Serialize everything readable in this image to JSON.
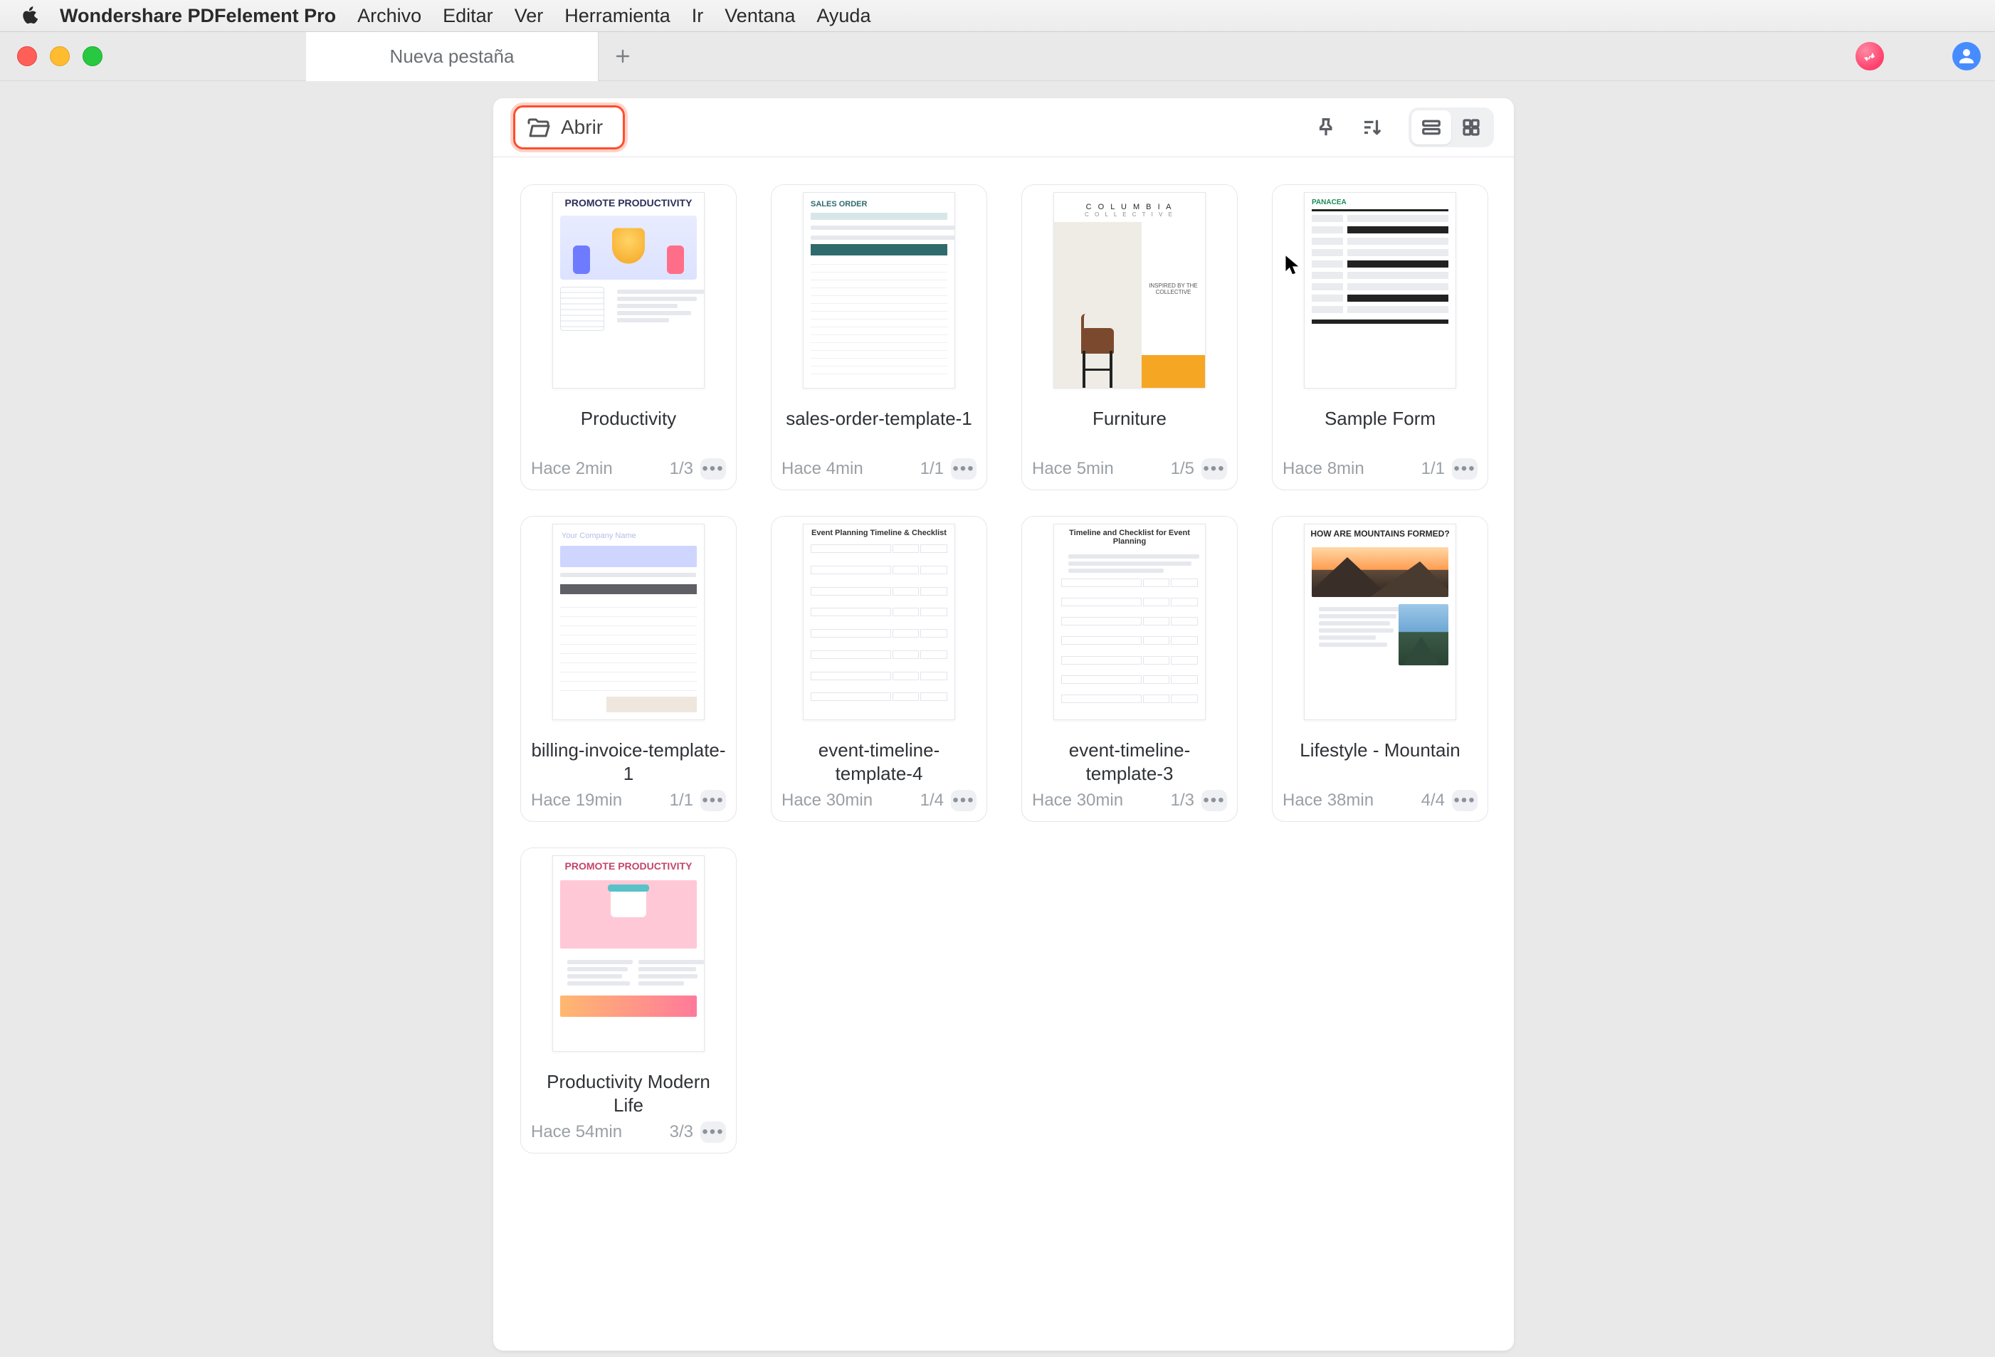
{
  "menubar": {
    "app_name": "Wondershare PDFelement Pro",
    "items": [
      "Archivo",
      "Editar",
      "Ver",
      "Herramienta",
      "Ir",
      "Ventana",
      "Ayuda"
    ]
  },
  "tabbar": {
    "tab_label": "Nueva pestaña"
  },
  "panel": {
    "open_label": "Abrir"
  },
  "files": [
    {
      "name": "Productivity",
      "time": "Hace 2min",
      "pages": "1/3",
      "thumb": "productivity"
    },
    {
      "name": "sales-order-template-1",
      "time": "Hace 4min",
      "pages": "1/1",
      "thumb": "sales"
    },
    {
      "name": "Furniture",
      "time": "Hace 5min",
      "pages": "1/5",
      "thumb": "furniture"
    },
    {
      "name": "Sample Form",
      "time": "Hace 8min",
      "pages": "1/1",
      "thumb": "form"
    },
    {
      "name": "billing-invoice-template-1",
      "time": "Hace 19min",
      "pages": "1/1",
      "thumb": "invoice"
    },
    {
      "name": "event-timeline-template-4",
      "time": "Hace 30min",
      "pages": "1/4",
      "thumb": "timeline"
    },
    {
      "name": "event-timeline-template-3",
      "time": "Hace 30min",
      "pages": "1/3",
      "thumb": "timeline2"
    },
    {
      "name": "Lifestyle - Mountain",
      "time": "Hace 38min",
      "pages": "4/4",
      "thumb": "mountain"
    },
    {
      "name": "Productivity Modern Life",
      "time": "Hace 54min",
      "pages": "3/3",
      "thumb": "modernlife"
    }
  ],
  "thumb_text": {
    "promote_productivity": "PROMOTE PRODUCTIVITY",
    "columbia": "C O L U M B I A",
    "collective": "C O L L E C T I V E",
    "inspired": "INSPIRED BY THE COLLECTIVE",
    "panacea": "PANACEA",
    "sales_order": "SALES ORDER",
    "your_company": "Your Company Name",
    "event4": "Event Planning Timeline & Checklist",
    "event3": "Timeline and Checklist for Event Planning",
    "mountains_q": "HOW ARE MOUNTAINS FORMED?"
  }
}
